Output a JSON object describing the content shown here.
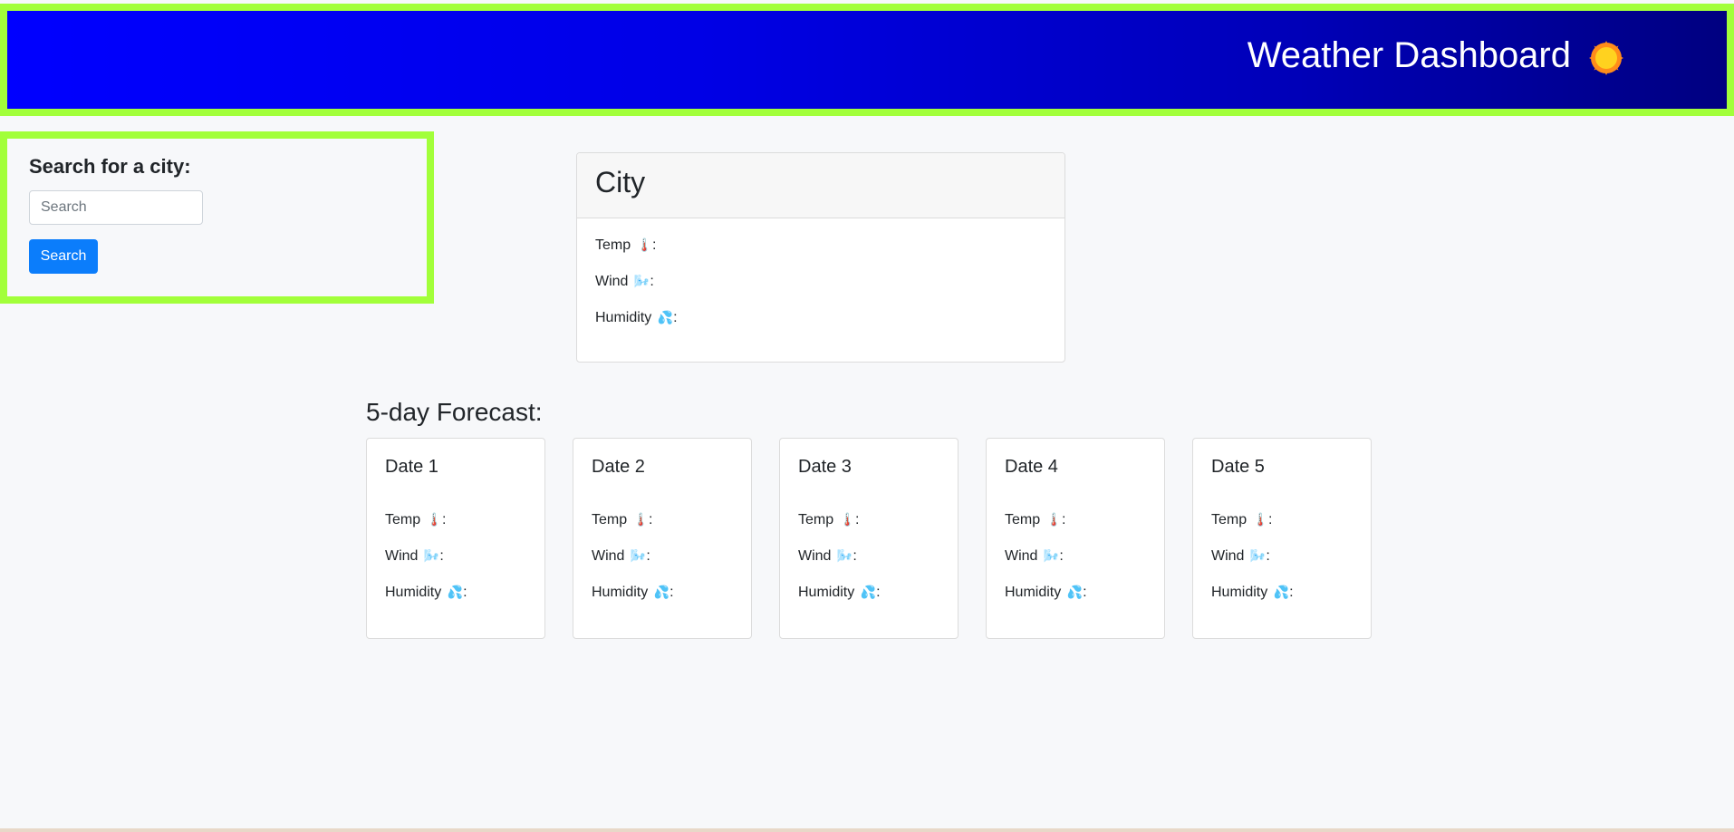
{
  "header": {
    "title": "Weather Dashboard",
    "icon": "sun-icon"
  },
  "search": {
    "heading": "Search for a city:",
    "placeholder": "Search",
    "value": "",
    "button_label": "Search"
  },
  "current": {
    "city": "City",
    "temp_label": "Temp",
    "temp_emoji": "🌡️",
    "wind_label": "Wind",
    "wind_emoji": "🌬️",
    "humidity_label": "Humidity",
    "humidity_emoji": "💦",
    "separator": ":"
  },
  "forecast": {
    "title": "5-day Forecast:",
    "days": [
      {
        "date": "Date 1",
        "temp": "Temp",
        "wind": "Wind",
        "humidity": "Humidity"
      },
      {
        "date": "Date 2",
        "temp": "Temp",
        "wind": "Wind",
        "humidity": "Humidity"
      },
      {
        "date": "Date 3",
        "temp": "Temp",
        "wind": "Wind",
        "humidity": "Humidity"
      },
      {
        "date": "Date 4",
        "temp": "Temp",
        "wind": "Wind",
        "humidity": "Humidity"
      },
      {
        "date": "Date 5",
        "temp": "Temp",
        "wind": "Wind",
        "humidity": "Humidity"
      }
    ]
  },
  "colors": {
    "header_gradient_start": "#0000ff",
    "header_gradient_end": "#000080",
    "highlight_border": "#a2ff3a",
    "button_bg": "#0b7dfb",
    "page_bg": "#f7f8fa"
  }
}
